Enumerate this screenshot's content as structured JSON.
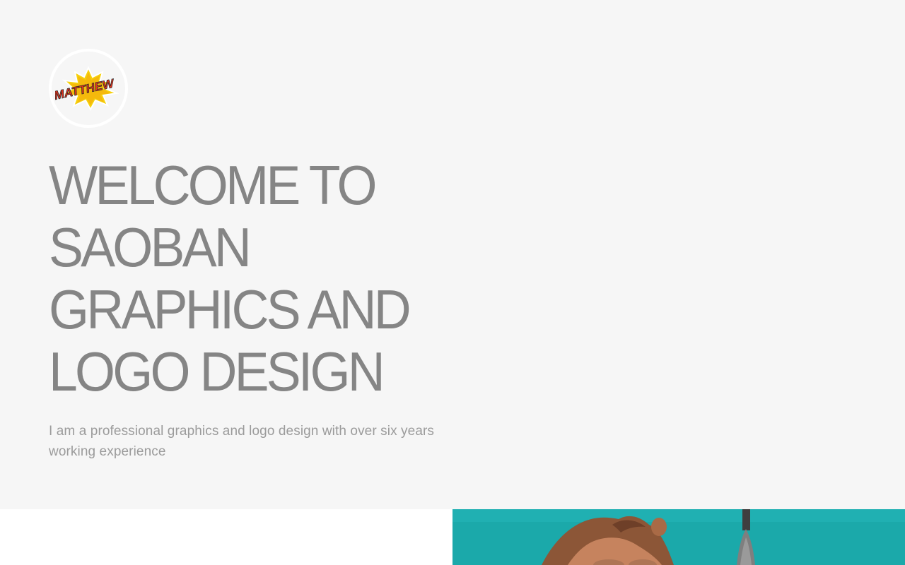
{
  "logo": {
    "text": "MATTHEW",
    "icon": "comic-burst-logo",
    "colors": {
      "burst": "#f6d10c",
      "text": "#e9331c",
      "outline": "#2a2a2a"
    }
  },
  "hero": {
    "title_lines": [
      "WELCOME TO",
      "SAOBAN",
      "GRAPHICS AND",
      "LOGO DESIGN"
    ],
    "subtitle": "I am a professional graphics and logo design with over six years working experience"
  },
  "colors": {
    "hero_background": "#f6f6f6",
    "title": "#858585",
    "subtitle": "#9b9b9b",
    "photo_background": "#1ba9aa"
  },
  "photo": {
    "icon": "cartoon-character-photo"
  }
}
